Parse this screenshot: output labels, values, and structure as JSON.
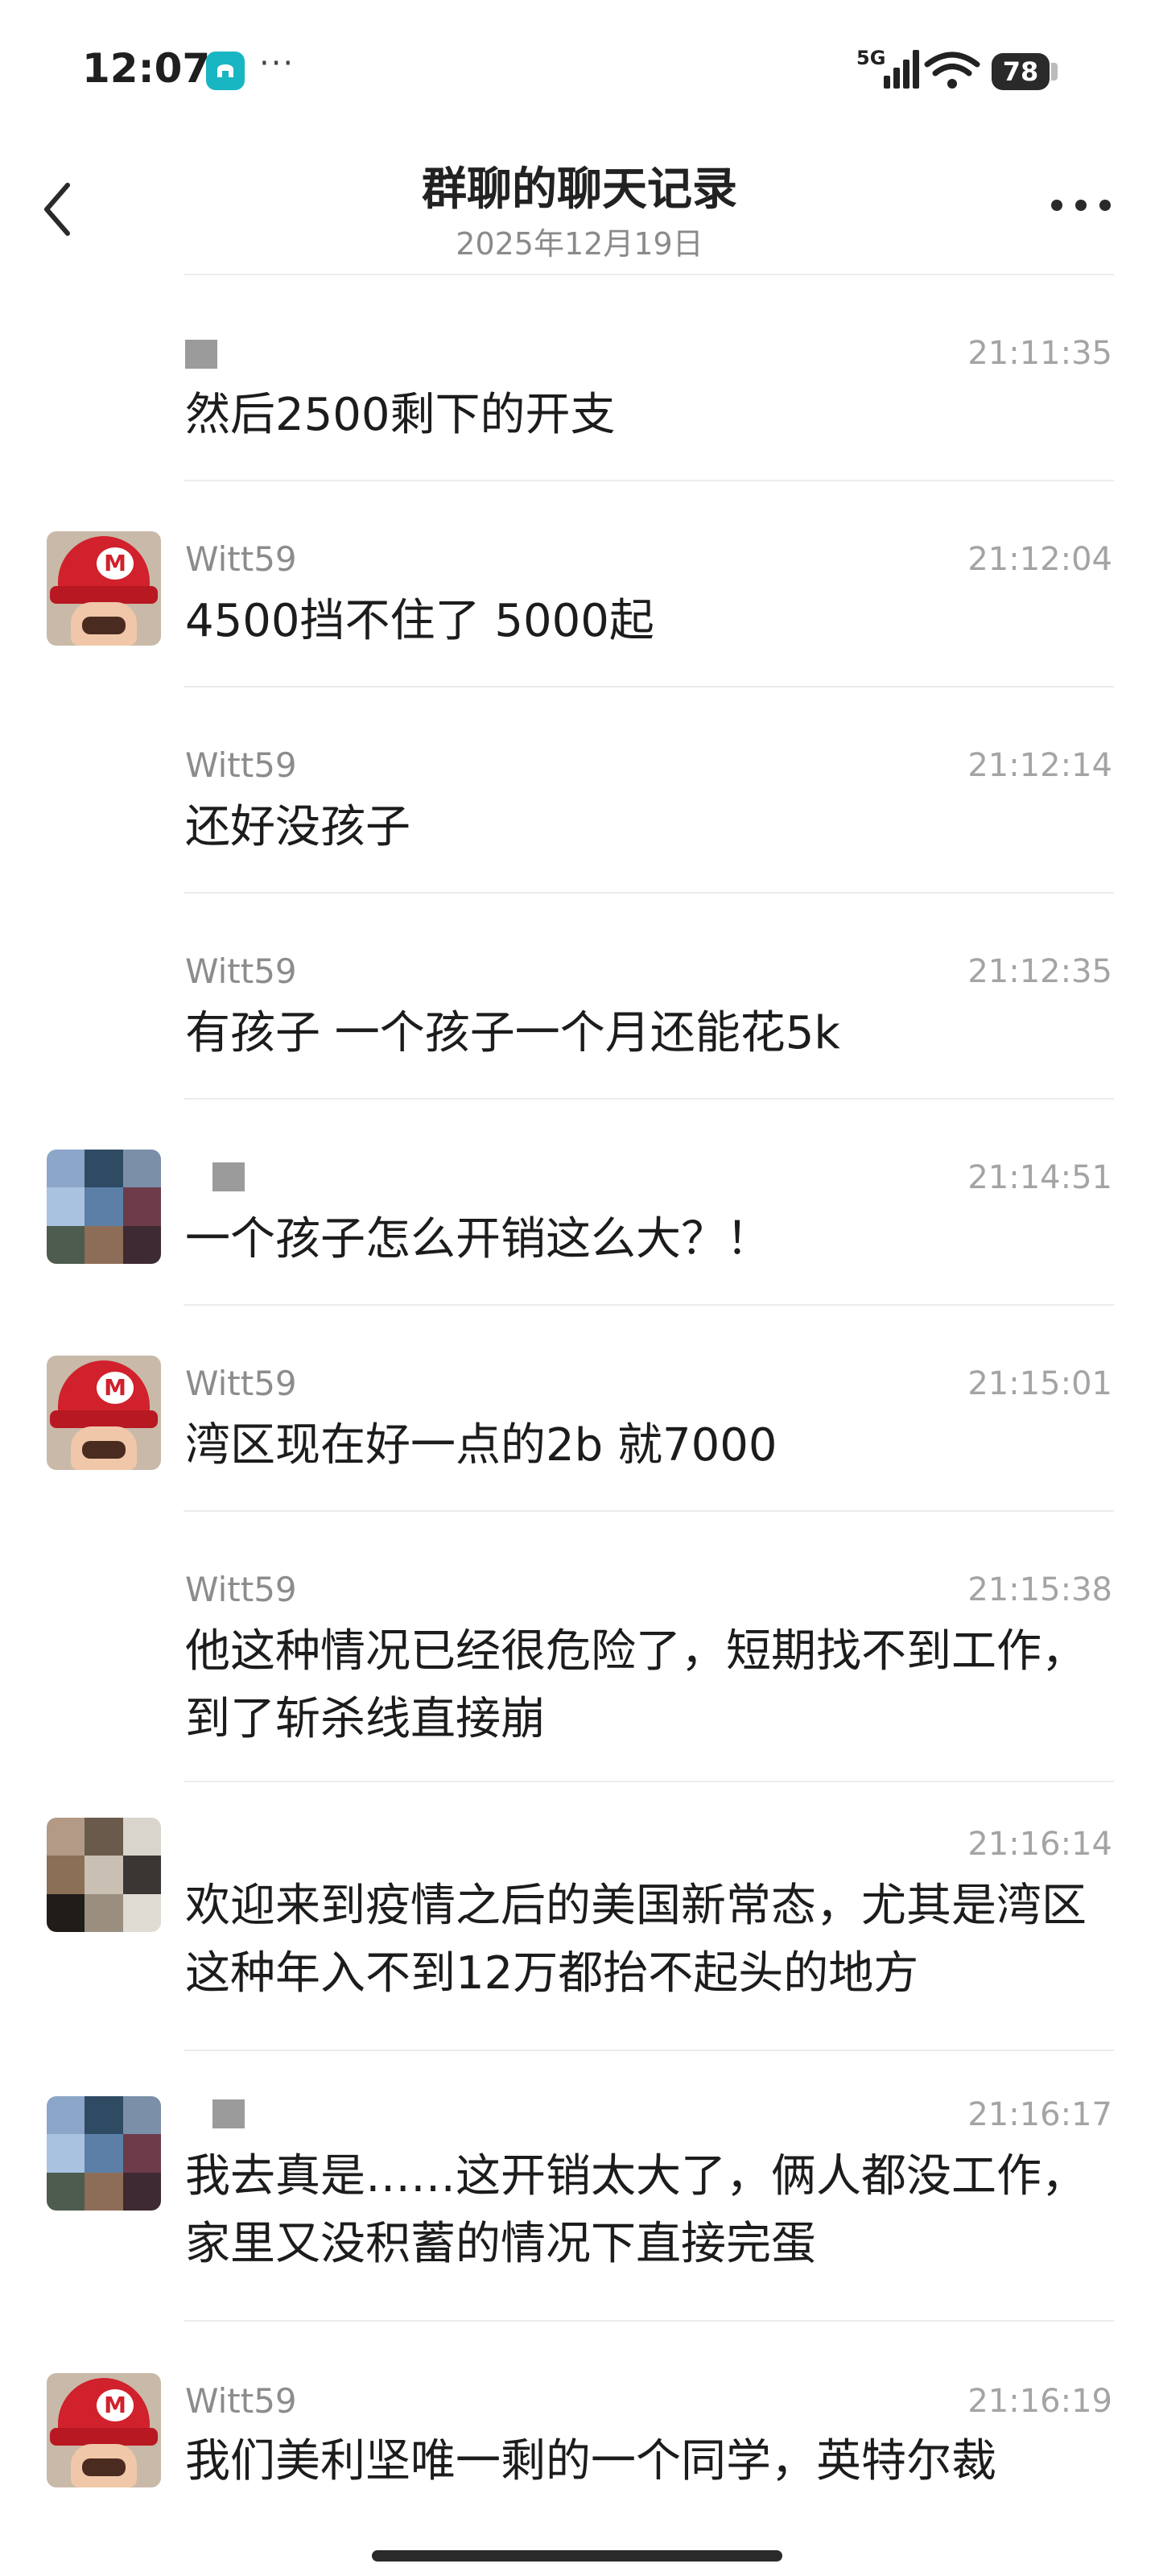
{
  "status_bar": {
    "time": "12:07",
    "more_indicator": "···",
    "network": "5G",
    "battery": "78",
    "icons": [
      "app-badge-icon",
      "signal-icon",
      "wifi-icon",
      "battery-icon"
    ]
  },
  "header": {
    "title": "群聊的聊天记录",
    "date": "2025年12月19日"
  },
  "messages": [
    {
      "sender": "",
      "time": "21:11:35",
      "text": "然后2500剩下的开支",
      "avatar": "none",
      "redacted_name": true
    },
    {
      "sender": "Witt59",
      "time": "21:12:04",
      "text": "4500挡不住了  5000起",
      "avatar": "mario"
    },
    {
      "sender": "Witt59",
      "time": "21:12:14",
      "text": "还好没孩子",
      "avatar": "none"
    },
    {
      "sender": "Witt59",
      "time": "21:12:35",
      "text": "有孩子 一个孩子一个月还能花5k",
      "avatar": "none"
    },
    {
      "sender": "",
      "time": "21:14:51",
      "text": "一个孩子怎么开销这么大？！",
      "avatar": "mosaic-a",
      "redacted_name": true
    },
    {
      "sender": "Witt59",
      "time": "21:15:01",
      "text": "湾区现在好一点的2b 就7000",
      "avatar": "mario"
    },
    {
      "sender": "Witt59",
      "time": "21:15:38",
      "text": "他这种情况已经很危险了，短期找不到工作，到了斩杀线直接崩",
      "avatar": "none"
    },
    {
      "sender": "",
      "time": "21:16:14",
      "text": "欢迎来到疫情之后的美国新常态，尤其是湾区这种年入不到12万都抬不起头的地方",
      "avatar": "mosaic-b"
    },
    {
      "sender": "",
      "time": "21:16:17",
      "text": "我去真是……这开销太大了，俩人都没工作，家里又没积蓄的情况下直接完蛋",
      "avatar": "mosaic-a",
      "redacted_name": true
    },
    {
      "sender": "Witt59",
      "time": "21:16:19",
      "text": "我们美利坚唯一剩的一个同学，英特尔裁",
      "avatar": "mario"
    }
  ],
  "colors": {
    "badge": "#18b6c3",
    "mario_red": "#d0212c",
    "meta_text": "#8c8c8c",
    "divider": "#ececec"
  }
}
